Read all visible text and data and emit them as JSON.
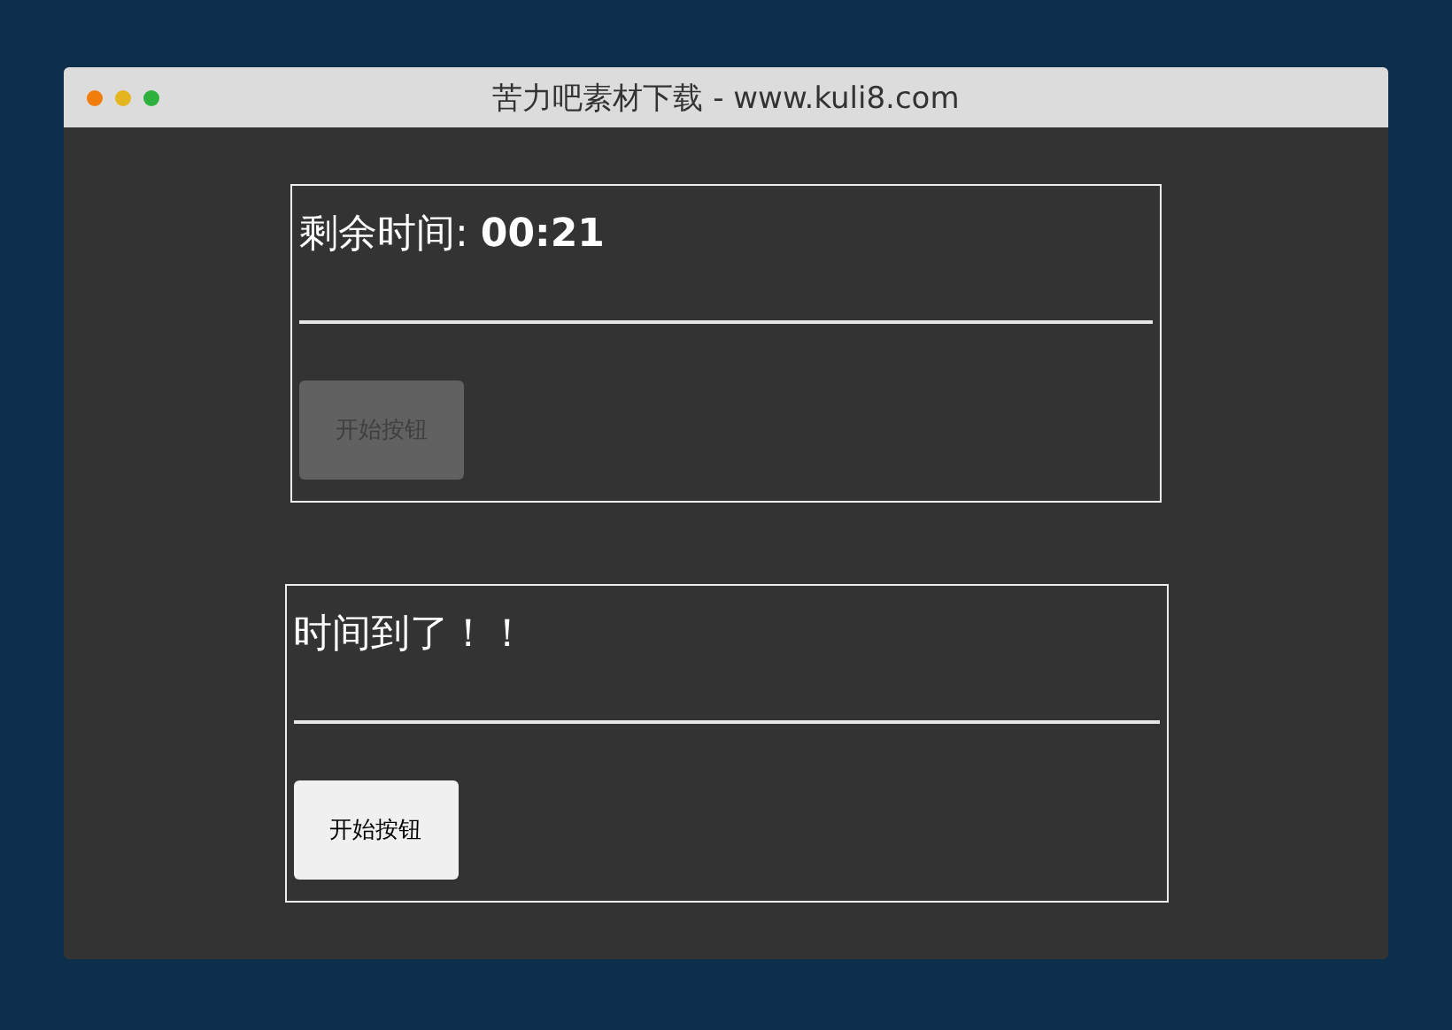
{
  "window": {
    "title": "苦力吧素材下载 - www.kuli8.com"
  },
  "panels": [
    {
      "message": "剩余时间: **00:21**",
      "button": {
        "label": "开始按钮",
        "disabled": true
      }
    },
    {
      "message": "时间到了！！",
      "button": {
        "label": "开始按钮",
        "disabled": false
      }
    }
  ]
}
